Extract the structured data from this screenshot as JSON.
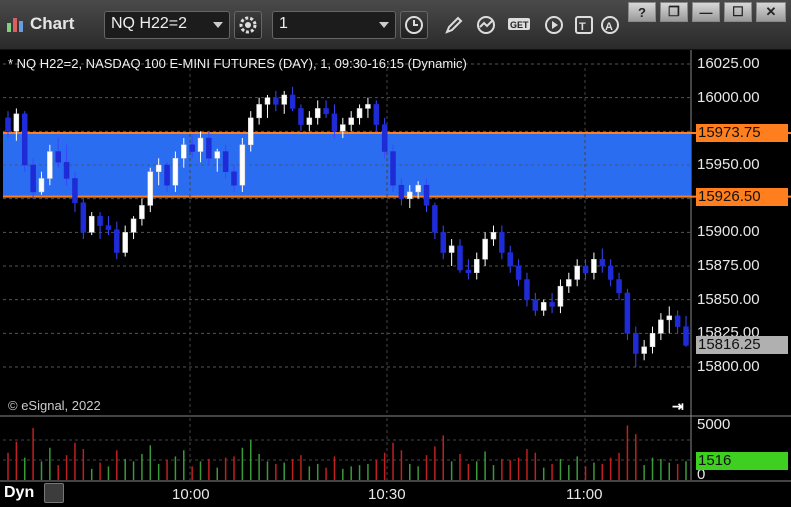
{
  "app": {
    "title": "Chart",
    "icon": "chart-icon"
  },
  "toolbar": {
    "symbol": "NQ H22=2",
    "interval": "1",
    "buttons": [
      "settings-icon",
      "clock-icon",
      "pencil-icon",
      "study-icon",
      "get-icon",
      "play-icon",
      "text-icon",
      "alert-icon"
    ]
  },
  "window_controls": [
    "?",
    "❐",
    "—",
    "☐",
    "✕"
  ],
  "chart_header": "* NQ H22=2, NASDAQ 100 E-MINI FUTURES (DAY), 1, 09:30-16:15 (Dynamic)",
  "copyright": "© eSignal, 2022",
  "footer": {
    "mode": "Dyn"
  },
  "colors": {
    "up_candle": "#ffffff",
    "down_candle": "#1f2bd6",
    "band_fill": "#2a6df0",
    "band_line": "#ff7f1e",
    "vol_up": "#3a9a3a",
    "vol_down": "#c02020",
    "last_price_bg": "#b0b0b0",
    "last_vol_bg": "#3fcf20"
  },
  "price_axis": {
    "ticks": [
      "16025.00",
      "16000.00",
      "15975.00",
      "15950.00",
      "15925.00",
      "15900.00",
      "15875.00",
      "15850.00",
      "15825.00",
      "15800.00"
    ],
    "upper_level": "15973.75",
    "lower_level": "15926.50",
    "last_price": "15816.25"
  },
  "volume_axis": {
    "top": "5000",
    "bottom": "0",
    "last": "1516"
  },
  "time_axis": [
    "10:00",
    "10:30",
    "11:00"
  ],
  "chart_data": {
    "type": "candlestick",
    "ylim": [
      15790,
      16030
    ],
    "band": [
      15926.5,
      15973.75
    ],
    "candles": [
      [
        15985,
        15990,
        15970,
        15975
      ],
      [
        15975,
        15992,
        15968,
        15988
      ],
      [
        15988,
        15990,
        15945,
        15950
      ],
      [
        15950,
        15955,
        15925,
        15930
      ],
      [
        15930,
        15945,
        15928,
        15940
      ],
      [
        15940,
        15965,
        15935,
        15960
      ],
      [
        15960,
        15970,
        15948,
        15952
      ],
      [
        15952,
        15965,
        15935,
        15940
      ],
      [
        15940,
        15945,
        15915,
        15922
      ],
      [
        15922,
        15925,
        15895,
        15900
      ],
      [
        15900,
        15915,
        15898,
        15912
      ],
      [
        15912,
        15915,
        15895,
        15905
      ],
      [
        15905,
        15912,
        15898,
        15902
      ],
      [
        15902,
        15908,
        15880,
        15885
      ],
      [
        15885,
        15905,
        15882,
        15900
      ],
      [
        15900,
        15912,
        15895,
        15910
      ],
      [
        15910,
        15925,
        15905,
        15920
      ],
      [
        15920,
        15948,
        15915,
        15945
      ],
      [
        15945,
        15955,
        15935,
        15950
      ],
      [
        15950,
        15952,
        15930,
        15935
      ],
      [
        15935,
        15960,
        15930,
        15955
      ],
      [
        15955,
        15970,
        15948,
        15965
      ],
      [
        15965,
        15972,
        15955,
        15960
      ],
      [
        15960,
        15975,
        15952,
        15970
      ],
      [
        15970,
        15975,
        15950,
        15955
      ],
      [
        15955,
        15962,
        15945,
        15960
      ],
      [
        15960,
        15965,
        15940,
        15945
      ],
      [
        15945,
        15950,
        15930,
        15935
      ],
      [
        15935,
        15970,
        15930,
        15965
      ],
      [
        15965,
        15990,
        15960,
        15985
      ],
      [
        15985,
        16000,
        15980,
        15995
      ],
      [
        15995,
        16002,
        15985,
        16000
      ],
      [
        16000,
        16005,
        15990,
        15995
      ],
      [
        15995,
        16005,
        15988,
        16002
      ],
      [
        16002,
        16008,
        15990,
        15992
      ],
      [
        15992,
        15995,
        15975,
        15980
      ],
      [
        15980,
        15990,
        15975,
        15985
      ],
      [
        15985,
        15998,
        15980,
        15992
      ],
      [
        15992,
        15998,
        15985,
        15988
      ],
      [
        15988,
        15995,
        15970,
        15975
      ],
      [
        15975,
        15985,
        15970,
        15980
      ],
      [
        15980,
        15990,
        15975,
        15985
      ],
      [
        15985,
        15995,
        15980,
        15992
      ],
      [
        15992,
        16000,
        15985,
        15995
      ],
      [
        15995,
        15998,
        15975,
        15980
      ],
      [
        15980,
        15985,
        15955,
        15960
      ],
      [
        15960,
        15965,
        15930,
        15935
      ],
      [
        15935,
        15940,
        15920,
        15925
      ],
      [
        15925,
        15935,
        15918,
        15930
      ],
      [
        15930,
        15938,
        15925,
        15935
      ],
      [
        15935,
        15940,
        15915,
        15920
      ],
      [
        15920,
        15922,
        15895,
        15900
      ],
      [
        15900,
        15905,
        15880,
        15885
      ],
      [
        15885,
        15895,
        15875,
        15890
      ],
      [
        15890,
        15895,
        15870,
        15872
      ],
      [
        15872,
        15880,
        15865,
        15870
      ],
      [
        15870,
        15885,
        15865,
        15880
      ],
      [
        15880,
        15900,
        15875,
        15895
      ],
      [
        15895,
        15905,
        15890,
        15900
      ],
      [
        15900,
        15905,
        15880,
        15885
      ],
      [
        15885,
        15890,
        15870,
        15875
      ],
      [
        15875,
        15880,
        15860,
        15865
      ],
      [
        15865,
        15870,
        15845,
        15850
      ],
      [
        15850,
        15855,
        15838,
        15842
      ],
      [
        15842,
        15850,
        15838,
        15848
      ],
      [
        15848,
        15855,
        15840,
        15845
      ],
      [
        15845,
        15865,
        15840,
        15860
      ],
      [
        15860,
        15870,
        15855,
        15865
      ],
      [
        15865,
        15880,
        15860,
        15875
      ],
      [
        15875,
        15880,
        15865,
        15870
      ],
      [
        15870,
        15885,
        15865,
        15880
      ],
      [
        15880,
        15888,
        15870,
        15875
      ],
      [
        15875,
        15880,
        15860,
        15865
      ],
      [
        15865,
        15870,
        15850,
        15855
      ],
      [
        15855,
        15858,
        15820,
        15825
      ],
      [
        15825,
        15830,
        15800,
        15810
      ],
      [
        15810,
        15820,
        15805,
        15815
      ],
      [
        15815,
        15830,
        15810,
        15825
      ],
      [
        15825,
        15840,
        15820,
        15835
      ],
      [
        15835,
        15845,
        15825,
        15838
      ],
      [
        15838,
        15842,
        15825,
        15830
      ],
      [
        15830,
        15838,
        15815,
        15816
      ]
    ],
    "volume": [
      [
        2200,
        "d"
      ],
      [
        3100,
        "d"
      ],
      [
        1800,
        "u"
      ],
      [
        4200,
        "d"
      ],
      [
        1500,
        "u"
      ],
      [
        2600,
        "u"
      ],
      [
        1200,
        "d"
      ],
      [
        2000,
        "d"
      ],
      [
        3000,
        "d"
      ],
      [
        2500,
        "d"
      ],
      [
        900,
        "u"
      ],
      [
        1400,
        "d"
      ],
      [
        1100,
        "u"
      ],
      [
        2400,
        "d"
      ],
      [
        1700,
        "u"
      ],
      [
        1500,
        "u"
      ],
      [
        2100,
        "u"
      ],
      [
        2800,
        "u"
      ],
      [
        1300,
        "u"
      ],
      [
        1600,
        "d"
      ],
      [
        1900,
        "u"
      ],
      [
        2400,
        "u"
      ],
      [
        1100,
        "d"
      ],
      [
        1500,
        "u"
      ],
      [
        1700,
        "d"
      ],
      [
        1000,
        "u"
      ],
      [
        1800,
        "d"
      ],
      [
        1900,
        "d"
      ],
      [
        2600,
        "u"
      ],
      [
        3200,
        "u"
      ],
      [
        2100,
        "u"
      ],
      [
        1500,
        "u"
      ],
      [
        1300,
        "d"
      ],
      [
        1400,
        "u"
      ],
      [
        1700,
        "d"
      ],
      [
        2000,
        "d"
      ],
      [
        1100,
        "u"
      ],
      [
        1300,
        "u"
      ],
      [
        1000,
        "d"
      ],
      [
        1900,
        "d"
      ],
      [
        900,
        "u"
      ],
      [
        1100,
        "u"
      ],
      [
        1200,
        "u"
      ],
      [
        1300,
        "u"
      ],
      [
        1600,
        "d"
      ],
      [
        2200,
        "d"
      ],
      [
        3000,
        "d"
      ],
      [
        2400,
        "d"
      ],
      [
        1300,
        "u"
      ],
      [
        1100,
        "u"
      ],
      [
        2000,
        "d"
      ],
      [
        2700,
        "d"
      ],
      [
        3600,
        "d"
      ],
      [
        1500,
        "u"
      ],
      [
        2100,
        "d"
      ],
      [
        1300,
        "d"
      ],
      [
        1500,
        "u"
      ],
      [
        2300,
        "u"
      ],
      [
        1200,
        "u"
      ],
      [
        1700,
        "d"
      ],
      [
        1600,
        "d"
      ],
      [
        1800,
        "d"
      ],
      [
        2500,
        "d"
      ],
      [
        2200,
        "d"
      ],
      [
        1000,
        "u"
      ],
      [
        1300,
        "d"
      ],
      [
        1700,
        "u"
      ],
      [
        1200,
        "u"
      ],
      [
        1900,
        "u"
      ],
      [
        1100,
        "d"
      ],
      [
        1400,
        "u"
      ],
      [
        1300,
        "d"
      ],
      [
        1800,
        "d"
      ],
      [
        2200,
        "d"
      ],
      [
        4400,
        "d"
      ],
      [
        3700,
        "d"
      ],
      [
        1200,
        "u"
      ],
      [
        1800,
        "u"
      ],
      [
        1700,
        "u"
      ],
      [
        1400,
        "u"
      ],
      [
        1300,
        "d"
      ],
      [
        1516,
        "u"
      ]
    ]
  }
}
